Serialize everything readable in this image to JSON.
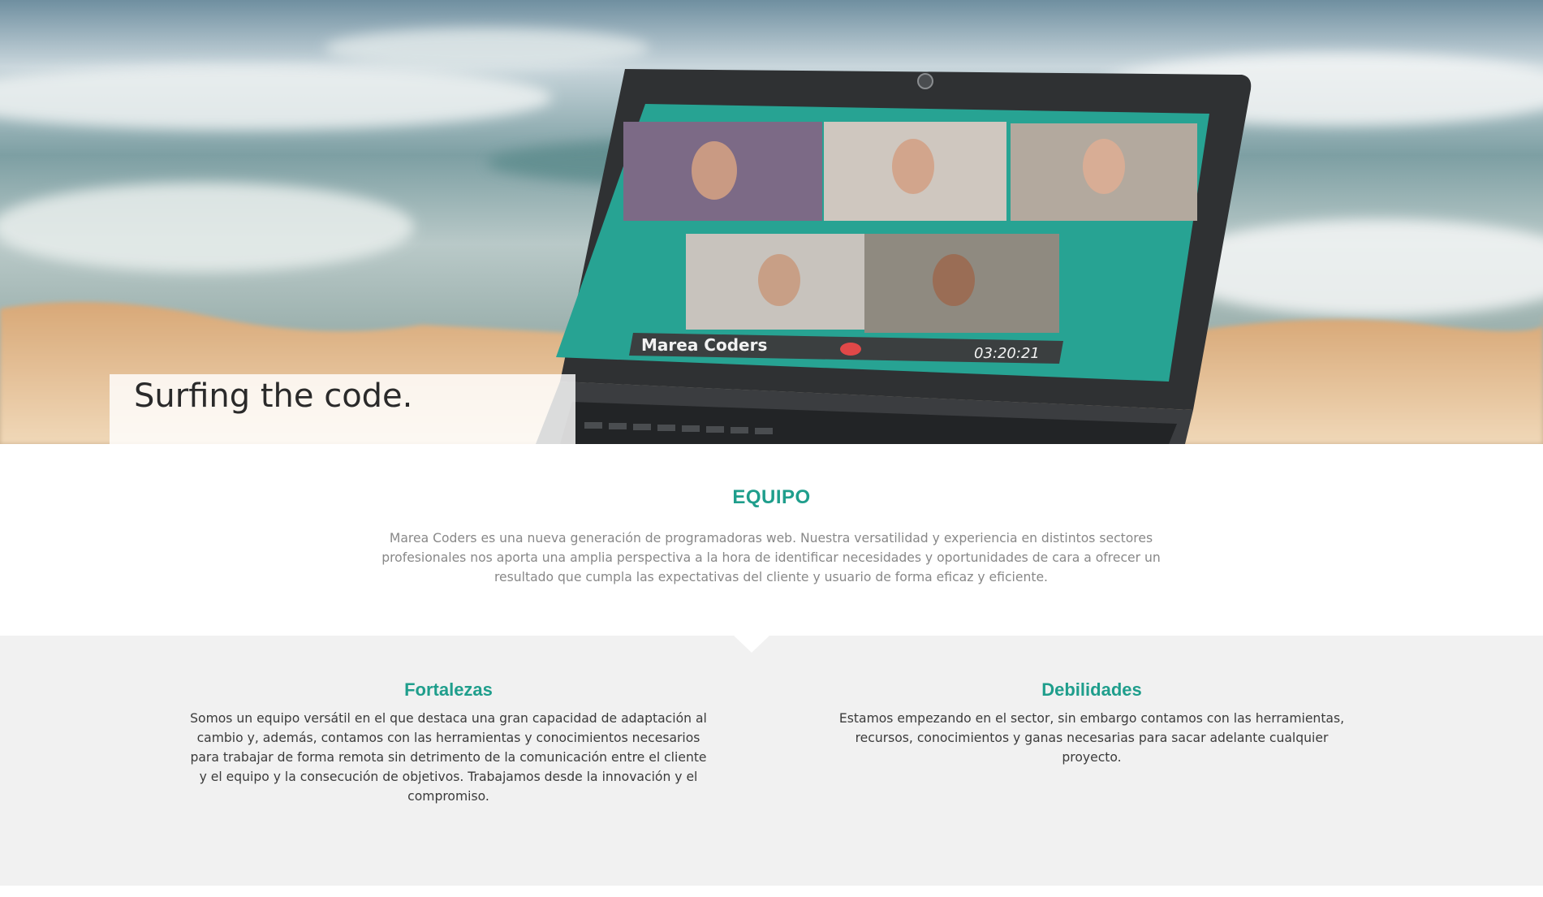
{
  "hero": {
    "tagline": "Surfing the code.",
    "screen_banner": "Marea Coders",
    "call_timer": "03:20:21"
  },
  "equipo": {
    "title": "EQUIPO",
    "description": "Marea Coders es una nueva generación de programadoras web. Nuestra versatilidad y experiencia en distintos sectores profesionales nos aporta una amplia perspectiva a la hora de identificar necesidades y oportunidades de cara a ofrecer un resultado que cumpla las expectativas del cliente y usuario de forma eficaz y eficiente."
  },
  "fortalezas": {
    "title": "Fortalezas",
    "text": "Somos un equipo versátil en el que destaca una gran capacidad de adaptación al cambio y, además, contamos con las herramientas y conocimientos necesarios para trabajar de forma remota sin detrimento de la comunicación entre el cliente y el equipo y la consecución de objetivos. Trabajamos desde la innovación y el compromiso."
  },
  "debilidades": {
    "title": "Debilidades",
    "text": "Estamos empezando en el sector, sin embargo contamos con las herramientas, recursos, conocimientos y ganas necesarias para sacar adelante cualquier proyecto."
  },
  "colors": {
    "accent": "#1f9e8c",
    "gray_section": "#f1f1f1",
    "body_text": "#888888"
  }
}
